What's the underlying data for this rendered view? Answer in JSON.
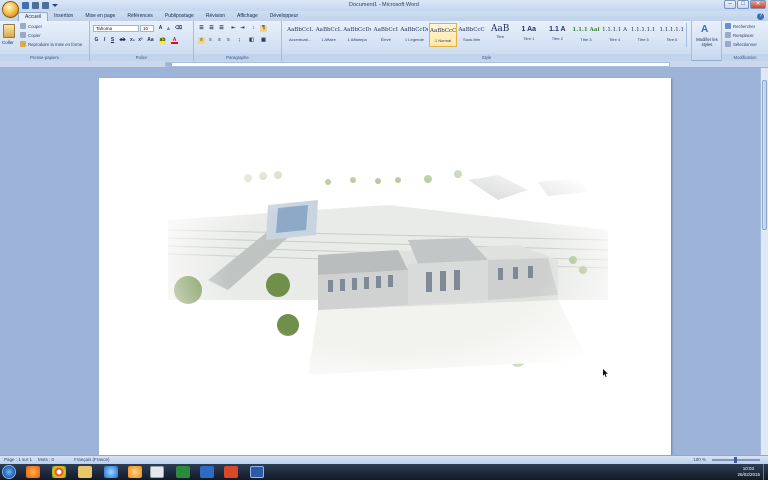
{
  "title_bar": {
    "title": "Document1 - Microsoft Word",
    "minimize": "–",
    "maximize": "□",
    "close": "✕"
  },
  "tabs": [
    "Accueil",
    "Insertion",
    "Mise en page",
    "Références",
    "Publipostage",
    "Révision",
    "Affichage",
    "Développeur"
  ],
  "clipboard": {
    "paste": "Coller",
    "cut": "Couper",
    "copy": "Copier",
    "format_painter": "Reproduire la mise en forme",
    "label": "Presse-papiers"
  },
  "font": {
    "name": "Tahoma",
    "size": "10",
    "label": "Police"
  },
  "paragraph": {
    "label": "Paragraphe"
  },
  "styles": {
    "label": "Style",
    "items": [
      {
        "sample": "AaBbCcL",
        "name": "Accentuati..."
      },
      {
        "sample": "AaBbCcL",
        "name": "1 Affaire"
      },
      {
        "sample": "AaBbCcDc",
        "name": "1 Affairepa"
      },
      {
        "sample": "AaBbCcI",
        "name": "Élevé"
      },
      {
        "sample": "AaBbCcDd",
        "name": "1 Légende"
      },
      {
        "sample": "AaBbCcC",
        "name": "1 Normal"
      },
      {
        "sample": "AaBbCcC",
        "name": "Sous-titre"
      },
      {
        "sample": "AaB",
        "name": "Titre"
      },
      {
        "sample": "1 Aa",
        "name": "Titre 1"
      },
      {
        "sample": "1.1 A",
        "name": "Titre 2"
      },
      {
        "sample": "1.1.1 Aal",
        "name": "Titre 3"
      },
      {
        "sample": "1.1.1.1 A",
        "name": "Titre 4"
      },
      {
        "sample": "1.1.1.1.1",
        "name": "Titre 5"
      },
      {
        "sample": "1.1.1.1.1",
        "name": "Titre 6"
      }
    ],
    "change": "Modifier les styles"
  },
  "editing": {
    "find": "Rechercher",
    "replace": "Remplacer",
    "select": "Sélectionner",
    "label": "Modification"
  },
  "status": {
    "page": "Page : 1 sur 1",
    "words": "Mots : 0",
    "language": "Français (France)",
    "zoom": "100 %"
  },
  "tray": {
    "time": "10:03",
    "date": "26/02/2015"
  },
  "colors": {
    "accent": "#3a6cc0",
    "page": "#ffffff"
  }
}
